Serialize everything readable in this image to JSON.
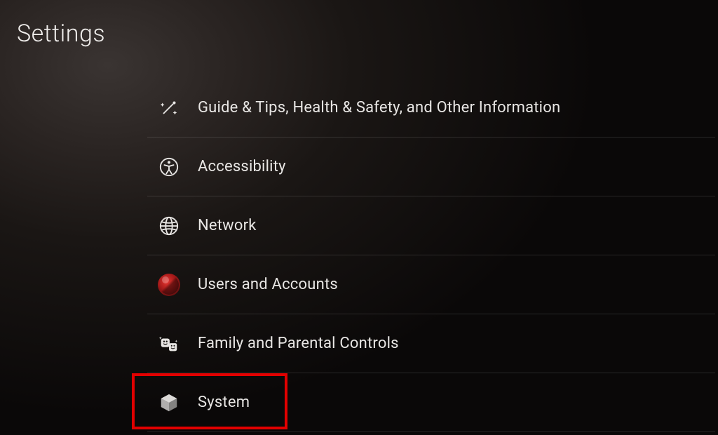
{
  "page": {
    "title": "Settings"
  },
  "menu": {
    "items": [
      {
        "id": "guide",
        "label": "Guide & Tips, Health & Safety, and Other Information",
        "icon": "wand-icon"
      },
      {
        "id": "accessibility",
        "label": "Accessibility",
        "icon": "accessibility-icon"
      },
      {
        "id": "network",
        "label": "Network",
        "icon": "globe-icon"
      },
      {
        "id": "users",
        "label": "Users and Accounts",
        "icon": "avatar-icon"
      },
      {
        "id": "family",
        "label": "Family and Parental Controls",
        "icon": "family-icon"
      },
      {
        "id": "system",
        "label": "System",
        "icon": "cube-icon"
      }
    ]
  },
  "annotation": {
    "highlight_item": "system"
  }
}
